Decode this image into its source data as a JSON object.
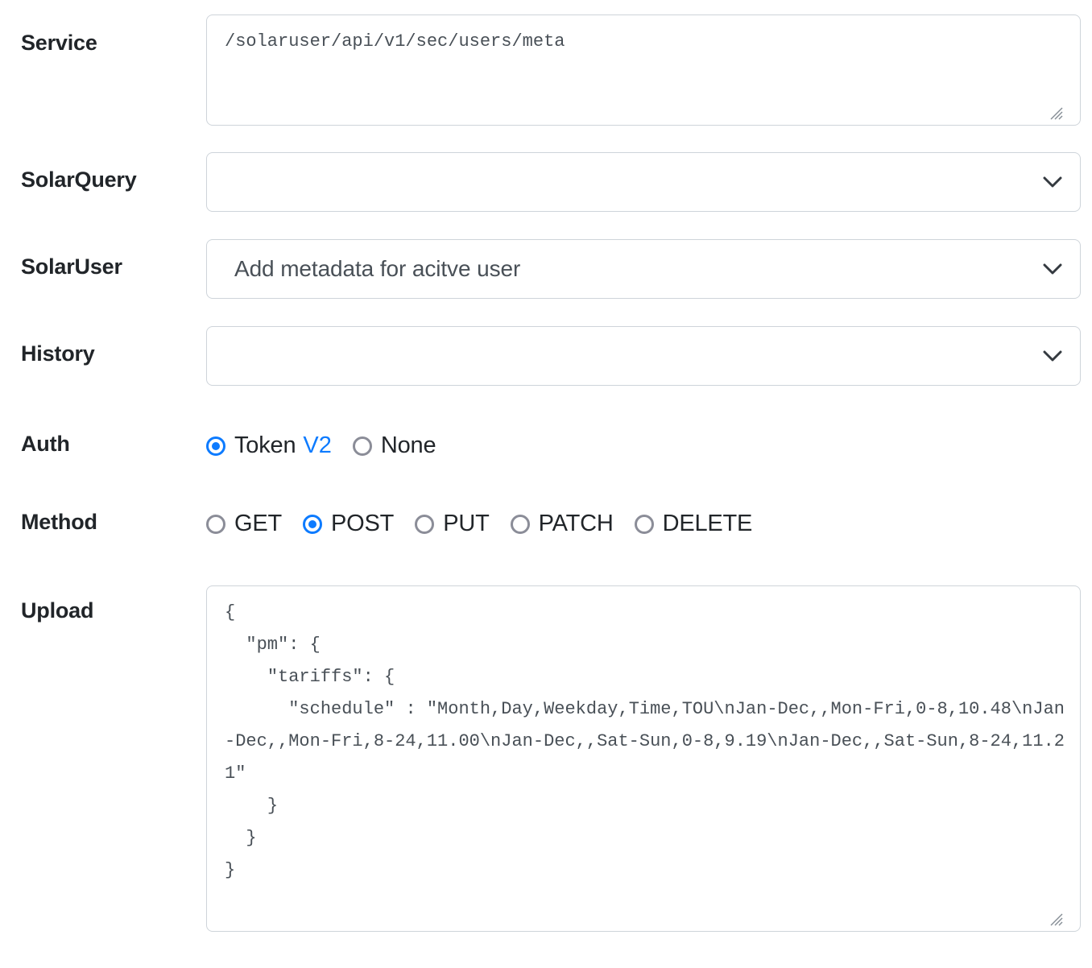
{
  "form": {
    "fields": {
      "service": {
        "label": "Service",
        "value": "/solaruser/api/v1/sec/users/meta"
      },
      "solarquery": {
        "label": "SolarQuery",
        "value": "",
        "icon": "chevron-down-icon"
      },
      "solaruser": {
        "label": "SolarUser",
        "value": "Add metadata for acitve user",
        "icon": "chevron-down-icon"
      },
      "history": {
        "label": "History",
        "value": "",
        "icon": "chevron-down-icon"
      },
      "auth": {
        "label": "Auth",
        "options": [
          {
            "label": "Token",
            "link_label": "V2",
            "checked": true
          },
          {
            "label": "None",
            "link_label": "",
            "checked": false
          }
        ]
      },
      "method": {
        "label": "Method",
        "options": [
          {
            "label": "GET",
            "checked": false
          },
          {
            "label": "POST",
            "checked": true
          },
          {
            "label": "PUT",
            "checked": false
          },
          {
            "label": "PATCH",
            "checked": false
          },
          {
            "label": "DELETE",
            "checked": false
          }
        ]
      },
      "upload": {
        "label": "Upload",
        "value": "{\n  \"pm\": {\n    \"tariffs\": {\n      \"schedule\" : \"Month,Day,Weekday,Time,TOU\\nJan-Dec,,Mon-Fri,0-8,10.48\\nJan-Dec,,Mon-Fri,8-24,11.00\\nJan-Dec,,Sat-Sun,0-8,9.19\\nJan-Dec,,Sat-Sun,8-24,11.21\"\n    }\n  }\n}"
      }
    }
  },
  "colors": {
    "accent": "#0d7bff",
    "label_text": "#212529",
    "input_text": "#495057",
    "border": "#ced4da",
    "radio_unchecked": "#8b8d98",
    "background": "#ffffff"
  }
}
